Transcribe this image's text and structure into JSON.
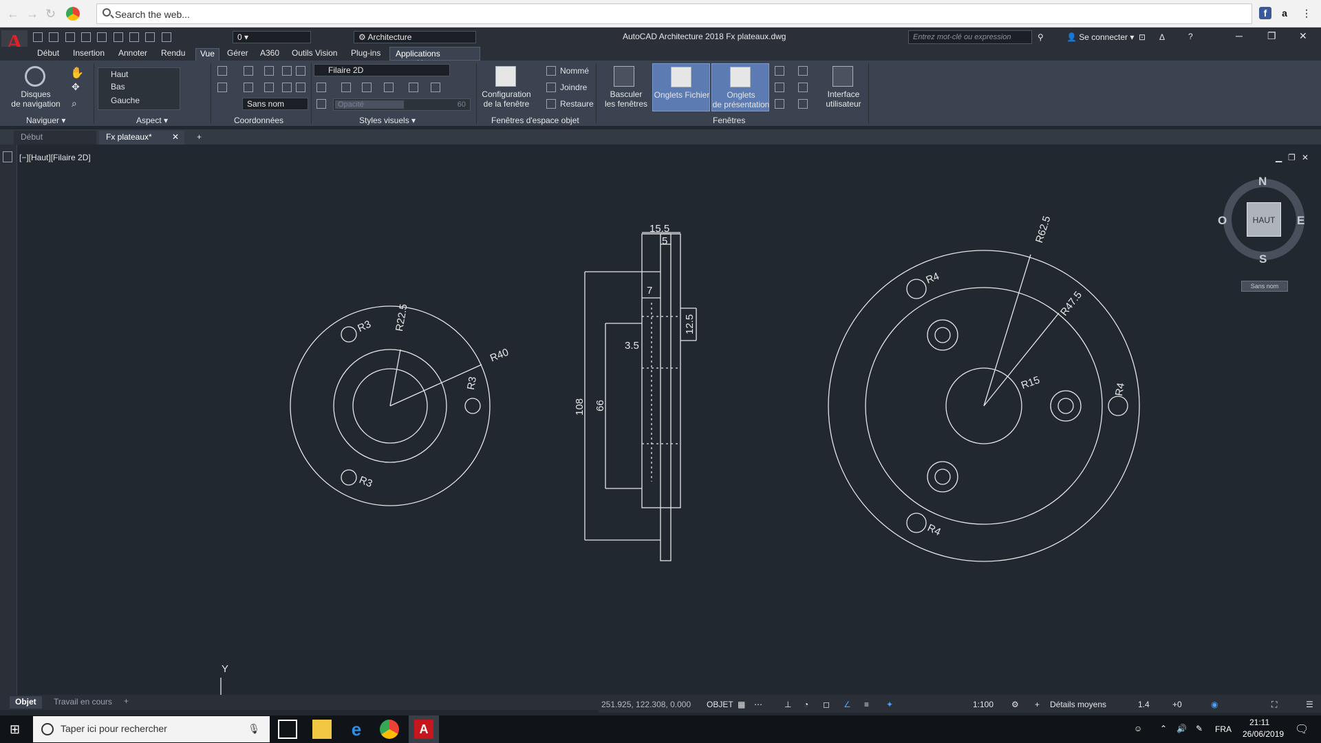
{
  "browser": {
    "omnibox_placeholder": "Search the web..."
  },
  "titlebar": {
    "title": "AutoCAD Architecture 2018   Fx plateaux.dwg",
    "layer_value": "0",
    "workspace": "Architecture",
    "keyword_search_placeholder": "Entrez mot-clé ou expression",
    "signin": "Se connecter"
  },
  "ribbon_tabs": [
    "Début",
    "Insertion",
    "Annoter",
    "Rendu",
    "Vue",
    "Gérer",
    "A360",
    "Outils Vision",
    "Plug-ins",
    "Applications associées"
  ],
  "ribbon": {
    "navigate": {
      "wheels": "Disques\nde navigation",
      "title": "Naviguer"
    },
    "aspect": {
      "views": [
        "Haut",
        "Bas",
        "Gauche"
      ],
      "title": "Aspect"
    },
    "coords": {
      "ucs": "Sans nom",
      "title": "Coordonnées"
    },
    "visual": {
      "style": "Filaire 2D",
      "opacity_label": "Opacité",
      "opacity_value": "60",
      "title": "Styles visuels"
    },
    "viewports": {
      "config": "Configuration\nde la fenêtre",
      "named": "Nommé",
      "join": "Joindre",
      "restore": "Restaure",
      "title": "Fenêtres d'espace objet"
    },
    "windows": {
      "switch": "Basculer\nles fenêtres",
      "file_tabs": "Onglets Fichier",
      "layout_tabs": "Onglets\nde présentation",
      "ui": "Interface\nutilisateur",
      "title": "Fenêtres"
    }
  },
  "doc_tabs": [
    "Début",
    "Fx plateaux*"
  ],
  "viewport": {
    "label": "[−][Haut][Filaire 2D]",
    "compass": {
      "n": "N",
      "s": "S",
      "e": "E",
      "w": "O",
      "cube": "HAUT",
      "ucs": "Sans nom"
    },
    "axis_y": "Y"
  },
  "dimensions": {
    "left": [
      "R3",
      "R22.5",
      "R40",
      "R3",
      "R3"
    ],
    "middle": [
      "15.5",
      "5",
      "7",
      "12.5",
      "3.5",
      "108",
      "66"
    ],
    "right": [
      "R62.5",
      "R4",
      "R47.5",
      "R15",
      "R4",
      "R4"
    ]
  },
  "layout_tabs": [
    "Objet",
    "Travail en cours"
  ],
  "statusbar": {
    "coords": "251.925, 122.308, 0.000",
    "model": "OBJET",
    "scale": "1:100",
    "detail": "Détails moyens",
    "lineweight": "1.4",
    "plus": "+0"
  },
  "taskbar": {
    "search_placeholder": "Taper ici pour rechercher",
    "lang": "FRA",
    "time": "21:11",
    "date": "26/06/2019"
  }
}
